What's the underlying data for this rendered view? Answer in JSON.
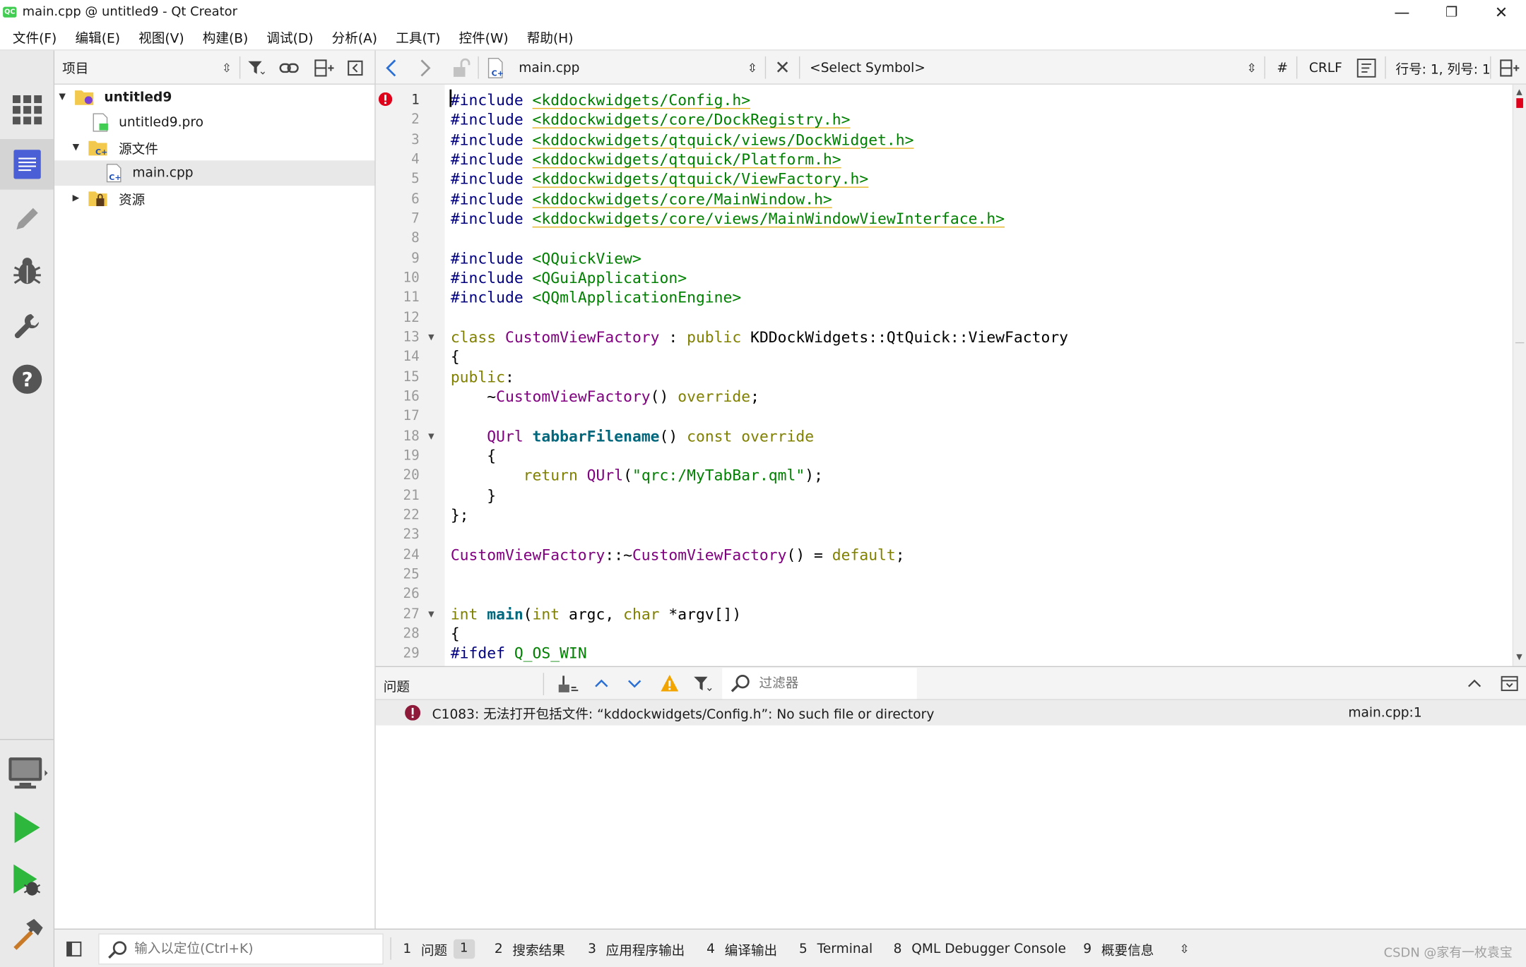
{
  "window": {
    "title": "main.cpp @ untitled9 - Qt Creator",
    "logo": "QC",
    "minimize": "—",
    "restore": "❐",
    "close": "✕"
  },
  "menu": [
    "文件(F)",
    "编辑(E)",
    "视图(V)",
    "构建(B)",
    "调试(D)",
    "分析(A)",
    "工具(T)",
    "控件(W)",
    "帮助(H)"
  ],
  "modes": [
    "welcome-icon",
    "edit-icon",
    "design-icon",
    "debug-icon",
    "projects-icon",
    "help-icon"
  ],
  "run_controls": [
    "kit-selector-icon",
    "run-icon",
    "debug-run-icon",
    "build-icon"
  ],
  "project_pane": {
    "title": "项目",
    "tree": [
      {
        "label": "untitled9",
        "level": 0,
        "bold": true,
        "expanded": true,
        "icon": "project-folder-icon"
      },
      {
        "label": "untitled9.pro",
        "level": 1,
        "icon": "pro-file-icon"
      },
      {
        "label": "源文件",
        "level": 1,
        "expanded": true,
        "icon": "source-folder-icon"
      },
      {
        "label": "main.cpp",
        "level": 2,
        "selected": true,
        "icon": "cpp-file-icon"
      },
      {
        "label": "资源",
        "level": 1,
        "expanded": false,
        "icon": "resource-folder-icon"
      }
    ]
  },
  "editor_toolbar": {
    "file": "main.cpp",
    "symbol": "<Select Symbol>",
    "hash": "#",
    "line_ending": "CRLF",
    "position": "行号: 1, 列号: 1"
  },
  "code": {
    "current_line": 1,
    "error_line": 1,
    "lines": [
      {
        "n": "1",
        "parts": [
          [
            "dir",
            "#include "
          ],
          [
            "inc",
            "<kddockwidgets/Config.h>"
          ]
        ]
      },
      {
        "n": "2",
        "parts": [
          [
            "dir",
            "#include "
          ],
          [
            "inc",
            "<kddockwidgets/core/DockRegistry.h>"
          ]
        ]
      },
      {
        "n": "3",
        "parts": [
          [
            "dir",
            "#include "
          ],
          [
            "inc",
            "<kddockwidgets/qtquick/views/DockWidget.h>"
          ]
        ]
      },
      {
        "n": "4",
        "parts": [
          [
            "dir",
            "#include "
          ],
          [
            "inc",
            "<kddockwidgets/qtquick/Platform.h>"
          ]
        ]
      },
      {
        "n": "5",
        "parts": [
          [
            "dir",
            "#include "
          ],
          [
            "inc",
            "<kddockwidgets/qtquick/ViewFactory.h>"
          ]
        ]
      },
      {
        "n": "6",
        "parts": [
          [
            "dir",
            "#include "
          ],
          [
            "inc",
            "<kddockwidgets/core/MainWindow.h>"
          ]
        ]
      },
      {
        "n": "7",
        "parts": [
          [
            "dir",
            "#include "
          ],
          [
            "inc",
            "<kddockwidgets/core/views/MainWindowViewInterface.h>"
          ]
        ]
      },
      {
        "n": "8",
        "parts": []
      },
      {
        "n": "9",
        "parts": [
          [
            "dir",
            "#include "
          ],
          [
            "incplain",
            "<QQuickView>"
          ]
        ]
      },
      {
        "n": "10",
        "parts": [
          [
            "dir",
            "#include "
          ],
          [
            "incplain",
            "<QGuiApplication>"
          ]
        ]
      },
      {
        "n": "11",
        "parts": [
          [
            "dir",
            "#include "
          ],
          [
            "incplain",
            "<QQmlApplicationEngine>"
          ]
        ]
      },
      {
        "n": "12",
        "parts": []
      },
      {
        "n": "13",
        "fold": true,
        "parts": [
          [
            "kw",
            "class "
          ],
          [
            "type",
            "CustomViewFactory"
          ],
          [
            "plain",
            " : "
          ],
          [
            "kw",
            "public "
          ],
          [
            "plain",
            "KDDockWidgets::QtQuick::ViewFactory"
          ]
        ]
      },
      {
        "n": "14",
        "parts": [
          [
            "plain",
            "{"
          ]
        ]
      },
      {
        "n": "15",
        "parts": [
          [
            "kw",
            "public"
          ],
          [
            "plain",
            ":"
          ]
        ]
      },
      {
        "n": "16",
        "parts": [
          [
            "plain",
            "    ~"
          ],
          [
            "type",
            "CustomViewFactory"
          ],
          [
            "plain",
            "() "
          ],
          [
            "kw",
            "override"
          ],
          [
            "plain",
            ";"
          ]
        ]
      },
      {
        "n": "17",
        "parts": []
      },
      {
        "n": "18",
        "fold": true,
        "parts": [
          [
            "plain",
            "    "
          ],
          [
            "type",
            "QUrl "
          ],
          [
            "fn",
            "tabbarFilename"
          ],
          [
            "plain",
            "() "
          ],
          [
            "kw",
            "const override"
          ]
        ]
      },
      {
        "n": "19",
        "parts": [
          [
            "plain",
            "    {"
          ]
        ]
      },
      {
        "n": "20",
        "parts": [
          [
            "plain",
            "        "
          ],
          [
            "kw",
            "return "
          ],
          [
            "type",
            "QUrl"
          ],
          [
            "plain",
            "("
          ],
          [
            "str",
            "\"qrc:/MyTabBar.qml\""
          ],
          [
            "plain",
            ");"
          ]
        ]
      },
      {
        "n": "21",
        "parts": [
          [
            "plain",
            "    }"
          ]
        ]
      },
      {
        "n": "22",
        "parts": [
          [
            "plain",
            "};"
          ]
        ]
      },
      {
        "n": "23",
        "parts": []
      },
      {
        "n": "24",
        "parts": [
          [
            "type",
            "CustomViewFactory"
          ],
          [
            "plain",
            "::~"
          ],
          [
            "type",
            "CustomViewFactory"
          ],
          [
            "plain",
            "() = "
          ],
          [
            "kw",
            "default"
          ],
          [
            "plain",
            ";"
          ]
        ]
      },
      {
        "n": "25",
        "parts": []
      },
      {
        "n": "26",
        "parts": []
      },
      {
        "n": "27",
        "fold": true,
        "parts": [
          [
            "kw",
            "int "
          ],
          [
            "fn",
            "main"
          ],
          [
            "plain",
            "("
          ],
          [
            "kw",
            "int "
          ],
          [
            "plain",
            "argc, "
          ],
          [
            "kw",
            "char "
          ],
          [
            "plain",
            "*argv[])"
          ]
        ]
      },
      {
        "n": "28",
        "parts": [
          [
            "plain",
            "{"
          ]
        ]
      },
      {
        "n": "29",
        "parts": [
          [
            "dir",
            "#ifdef "
          ],
          [
            "incplain",
            "Q_OS_WIN"
          ]
        ]
      }
    ]
  },
  "issues_pane": {
    "title": "问题",
    "filter_placeholder": "过滤器",
    "issues": [
      {
        "message": "C1083: 无法打开包括文件: “kddockwidgets/Config.h”: No such file or directory",
        "location": "main.cpp:1",
        "severity": "error"
      }
    ]
  },
  "statusbar": {
    "locator_placeholder": "输入以定位(Ctrl+K)",
    "tabs": [
      {
        "num": "1",
        "label": "问题",
        "badge": "1"
      },
      {
        "num": "2",
        "label": "搜索结果"
      },
      {
        "num": "3",
        "label": "应用程序输出"
      },
      {
        "num": "4",
        "label": "编译输出"
      },
      {
        "num": "5",
        "label": "Terminal"
      },
      {
        "num": "8",
        "label": "QML Debugger Console"
      },
      {
        "num": "9",
        "label": "概要信息"
      }
    ],
    "watermark": "CSDN @家有一枚袁宝"
  },
  "colors": {
    "keyword": "#808000",
    "type": "#800080",
    "directive": "#000080",
    "string": "#008000",
    "function": "#00677c",
    "error": "#e0001a",
    "run_green": "#2db83d"
  }
}
